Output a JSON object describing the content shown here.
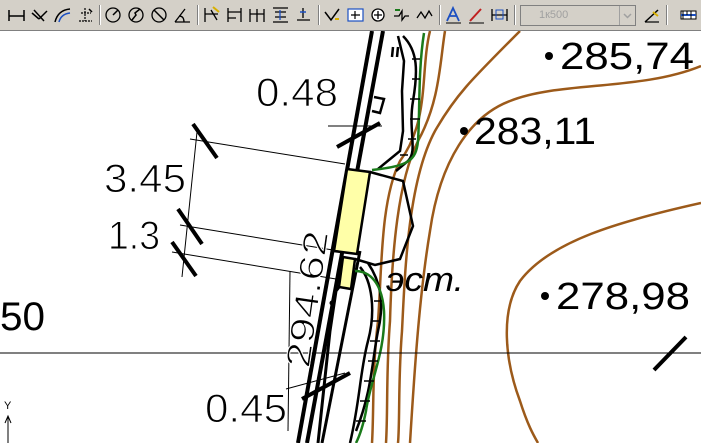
{
  "toolbar": {
    "scale_value": "1к500",
    "icons": [
      "dimension-linear-icon",
      "dimension-aligned-icon",
      "dimension-arc-icon",
      "dimension-ordinate-icon",
      "dimension-radius-icon",
      "dimension-jogged-icon",
      "dimension-diameter-icon",
      "dimension-angular-icon",
      "quick-dimension-icon",
      "dimension-baseline-icon",
      "dimension-continue-icon",
      "dimension-space-icon",
      "dimension-break-icon",
      "tolerance-icon",
      "center-mark-icon",
      "inspection-icon",
      "jogged-linear-icon",
      "dimension-edit-icon",
      "text-style-icon",
      "dimension-text-edit-icon",
      "dimension-update-icon",
      "dimension-style-icon",
      "dimension-override-icon"
    ],
    "colors": {
      "face": "#d4d0c8",
      "shadow": "#808080"
    }
  },
  "drawing": {
    "dimensions": [
      {
        "text": "0.48"
      },
      {
        "text": "3.45"
      },
      {
        "text": "1.3"
      },
      {
        "text": "294.62"
      },
      {
        "text": "0.45"
      }
    ],
    "elevations": [
      {
        "text": "285,74"
      },
      {
        "text": "283,11"
      },
      {
        "text": "278,98"
      }
    ],
    "partial_label": "50",
    "annotation": "эст.",
    "ucs_axis_label": "Y",
    "colors": {
      "contour": "#9c5a1a",
      "edge": "#1a7a1a",
      "highlight": "#ffffa8",
      "line": "#000000"
    }
  }
}
